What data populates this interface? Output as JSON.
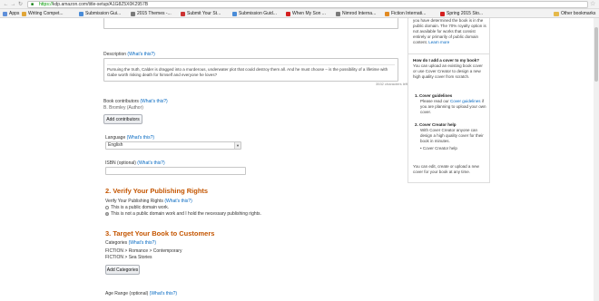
{
  "browser": {
    "url_scheme": "https://",
    "url_rest": "kdp.amazon.com/title-setup/A1G8Z5X0K2957B",
    "bookmarks": [
      {
        "label": "Apps",
        "color": "#5f8fd9",
        "folder": false
      },
      {
        "label": "Writing Compet...",
        "color": "#e1a637",
        "folder": false
      },
      {
        "label": "Submission Gui...",
        "color": "#4a8cd8",
        "folder": false
      },
      {
        "label": "2015 Themes -...",
        "color": "#7a7a7a",
        "folder": false
      },
      {
        "label": "Submit Your St...",
        "color": "#cc3333",
        "folder": false
      },
      {
        "label": "Submission Guid...",
        "color": "#4a8cd8",
        "folder": false
      },
      {
        "label": "When My Son ...",
        "color": "#d42020",
        "folder": false
      },
      {
        "label": "Nimrod Interna...",
        "color": "#7a7a7a",
        "folder": false
      },
      {
        "label": "Fiction Internati...",
        "color": "#e18a22",
        "folder": false
      },
      {
        "label": "Spring 2015 Sto...",
        "color": "#d42020",
        "folder": false
      },
      {
        "label": "Other bookmarks",
        "color": "#e5b94a",
        "folder": true
      }
    ]
  },
  "description": {
    "label": "Description",
    "help": "(What's this?)",
    "text": "Pursuing the truth, Calder is dragged into a murderous, underwater plot that could destroy them all. And he must choose – is the possibility of a lifetime with Gabe worth risking death for himself and everyone he loves?",
    "counter": "3532 characters left"
  },
  "contributors": {
    "label": "Book contributors",
    "help": "(What's this?)",
    "author": "B. Bromley (Author)",
    "button": "Add contributors"
  },
  "language": {
    "label": "Language",
    "help": "(What's this?)",
    "value": "English"
  },
  "isbn": {
    "label": "ISBN (optional)",
    "help": "(What's this?)",
    "value": ""
  },
  "section2": {
    "title": "2. Verify Your Publishing Rights",
    "label": "Verify Your Publishing Rights",
    "help": "(What's this?)",
    "option1": "This is a public domain work.",
    "option2": "This is not a public domain work and I hold the necessary publishing rights."
  },
  "section3": {
    "title": "3. Target Your Book to Customers",
    "categories_label": "Categories",
    "help": "(What's this?)",
    "categories": [
      "FICTION > Romance > Contemporary",
      "FICTION > Sea Stories"
    ],
    "button": "Add Categories",
    "age_label": "Age Range (optional)",
    "age_help": "(What's this?)"
  },
  "sidebar": {
    "top_text": "you have determined the book is in the public domain. The 70% royalty option is not available for works that consist entirely or primarily of public domain content.",
    "top_link": "Learn more",
    "q_title": "How do I add a cover to my book?",
    "q_text": "You can upload an existing book cover or use Cover Creator to design a new high quality cover from scratch.",
    "item1_title": "1.  Cover guidelines",
    "item1_text": "Please read our ",
    "item1_link": "Cover guidelines",
    "item1_text2": " if you are planning to upload your own cover.",
    "item2_title": "2.  Cover Creator help",
    "item2_text": "With Cover Creator anyone can design a high quality cover for their book in minutes.",
    "item2_link": "• Cover Creator help",
    "bottom_text": "You can edit, create or upload a new cover for your book at any time."
  }
}
